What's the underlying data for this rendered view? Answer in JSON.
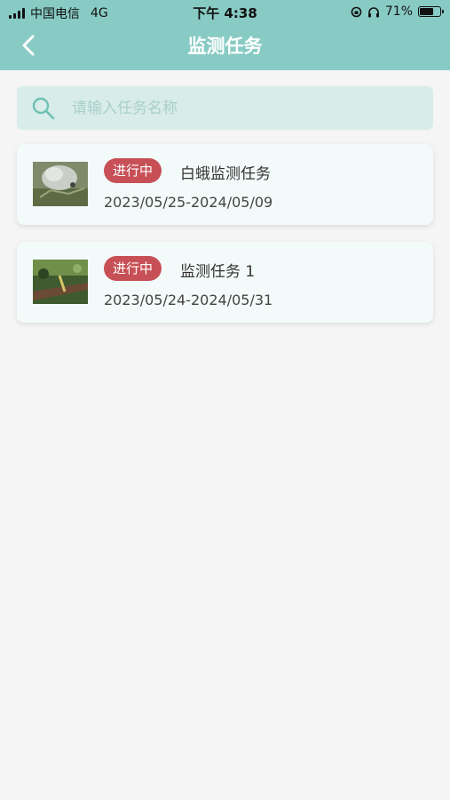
{
  "status_bar": {
    "carrier": "中国电信",
    "network": "4G",
    "time": "下午 4:38",
    "battery": "71%",
    "battery_level": 0.71
  },
  "header": {
    "title": "监测任务",
    "back_icon": "chevron-left-icon"
  },
  "search": {
    "placeholder": "请输入任务名称",
    "value": ""
  },
  "tasks": [
    {
      "status": "进行中",
      "name": "白蛾监测任务",
      "date_range": "2023/05/25-2024/05/09"
    },
    {
      "status": "进行中",
      "name": "监测任务 1",
      "date_range": "2023/05/24-2024/05/31"
    }
  ],
  "colors": {
    "header": "#88cbc4",
    "badge": "#c75056",
    "search_bg": "#d8ece9",
    "card_bg": "#f3fbfa"
  }
}
